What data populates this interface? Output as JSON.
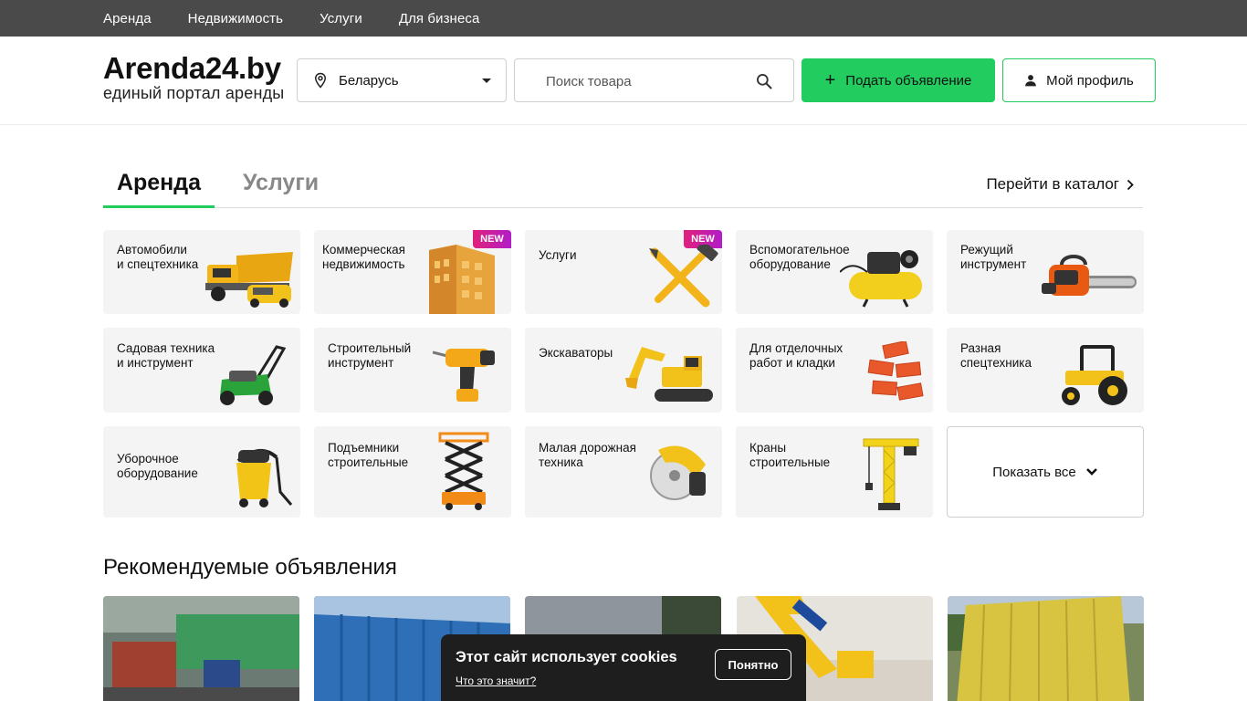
{
  "topnav": [
    "Аренда",
    "Недвижимость",
    "Услуги",
    "Для бизнеса"
  ],
  "logo": {
    "title": "Arenda24.by",
    "subtitle": "единый портал аренды"
  },
  "region": {
    "value": "Беларусь"
  },
  "search": {
    "placeholder": "Поиск товара"
  },
  "buttons": {
    "post": "Подать объявление",
    "profile": "Мой профиль"
  },
  "tabs": {
    "active": "Аренда",
    "inactive": "Услуги",
    "catalog": "Перейти в каталог"
  },
  "badge": "NEW",
  "categories": [
    {
      "line1": "Автомобили",
      "line2": "и спецтехника",
      "icon": "truck-icon"
    },
    {
      "line1": "Коммерческая",
      "line2": "недвижимость",
      "icon": "building-icon",
      "badge": true
    },
    {
      "line1": "Услуги",
      "line2": "",
      "icon": "tools-icon",
      "badge": true
    },
    {
      "line1": "Вспомогательное",
      "line2": "оборудование",
      "icon": "compressor-icon"
    },
    {
      "line1": "Режущий",
      "line2": "инструмент",
      "icon": "chainsaw-icon"
    },
    {
      "line1": "Садовая техника",
      "line2": "и инструмент",
      "icon": "lawnmower-icon"
    },
    {
      "line1": "Строительный",
      "line2": "инструмент",
      "icon": "drill-icon"
    },
    {
      "line1": "Экскаваторы",
      "line2": "",
      "icon": "excavator-icon"
    },
    {
      "line1": "Для отделочных",
      "line2": "работ и кладки",
      "icon": "bricks-icon"
    },
    {
      "line1": "Разная",
      "line2": "спецтехника",
      "icon": "tractor-icon"
    },
    {
      "line1": "Уборочное",
      "line2": "оборудование",
      "icon": "vacuum-icon"
    },
    {
      "line1": "Подъемники",
      "line2": "строительные",
      "icon": "scissor-lift-icon"
    },
    {
      "line1": "Малая дорожная",
      "line2": "техника",
      "icon": "road-saw-icon"
    },
    {
      "line1": "Краны",
      "line2": "строительные",
      "icon": "crane-icon"
    }
  ],
  "show_all": "Показать все",
  "recommended": {
    "title": "Рекомендуемые объявления"
  },
  "cookie": {
    "title": "Этот сайт использует cookies",
    "link": "Что это значит?",
    "button": "Понятно"
  },
  "colors": {
    "accent": "#22cc5e",
    "topnav": "#4a4a4a",
    "tile": "#f4f4f4",
    "cookie": "#1e1e1e",
    "badge": "#d41f8f"
  }
}
